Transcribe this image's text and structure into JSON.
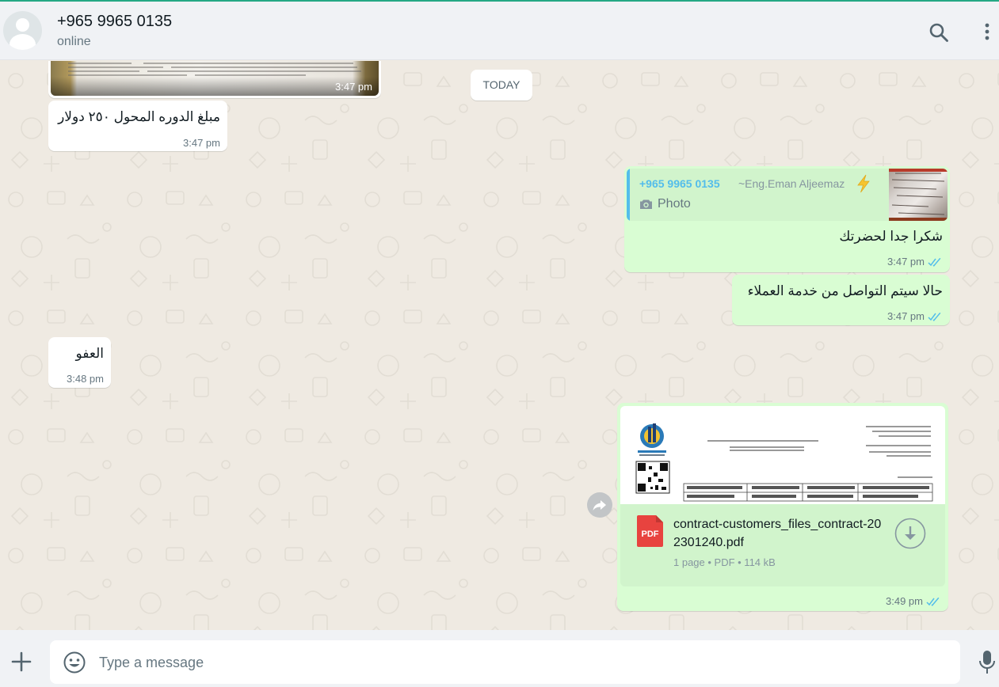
{
  "header": {
    "contact_name": "+965 9965 0135",
    "status": "online",
    "search_icon": "search-icon",
    "menu_icon": "kebab-menu-icon"
  },
  "date_divider": "TODAY",
  "messages": [
    {
      "id": "m1",
      "direction": "incoming",
      "type": "image",
      "time": "3:47 pm"
    },
    {
      "id": "m2",
      "direction": "incoming",
      "type": "text",
      "text": "مبلغ الدوره المحول ٢٥٠ دولار",
      "time": "3:47 pm"
    },
    {
      "id": "m3",
      "direction": "outgoing",
      "type": "reply",
      "text": "شكرا جدا لحضرتك",
      "time": "3:47 pm",
      "status": "read",
      "quote": {
        "sender": "+965 9965 0135",
        "push_name": "~Eng.Eman Aljeemaz",
        "kind": "Photo"
      }
    },
    {
      "id": "m4",
      "direction": "outgoing",
      "type": "text",
      "text": "حالا سيتم التواصل من خدمة العملاء",
      "time": "3:47 pm",
      "status": "read"
    },
    {
      "id": "m5",
      "direction": "incoming",
      "type": "text",
      "text": "العفو",
      "time": "3:48 pm"
    },
    {
      "id": "m6",
      "direction": "outgoing",
      "type": "document",
      "time": "3:49 pm",
      "status": "read",
      "file": {
        "name": "contract-customers_files_contract-202301240.pdf",
        "badge": "PDF",
        "meta": "1 page • PDF • 114 kB"
      }
    }
  ],
  "composer": {
    "placeholder": "Type a message",
    "attach_icon": "plus-icon",
    "emoji_icon": "emoji-icon",
    "mic_icon": "microphone-icon"
  },
  "colors": {
    "outgoing_bubble": "#d9fdd3",
    "incoming_bubble": "#ffffff",
    "read_ticks": "#53bdeb",
    "chat_background": "#efeae2"
  }
}
